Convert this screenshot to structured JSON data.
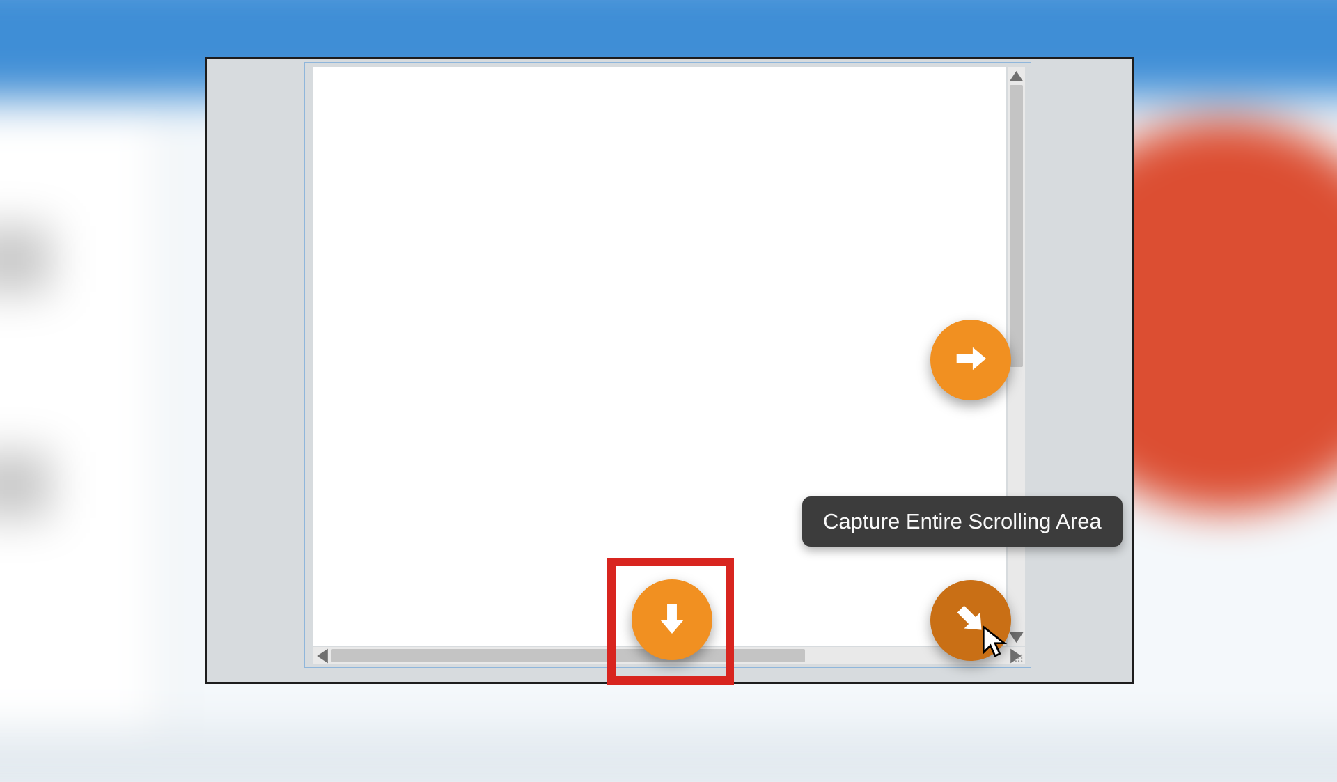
{
  "tooltip": {
    "capture_entire": "Capture Entire Scrolling Area"
  },
  "icons": {
    "scroll_right": "arrow-right-icon",
    "scroll_down": "arrow-down-icon",
    "scroll_diagonal": "arrow-down-right-icon"
  },
  "colors": {
    "button_orange": "#f19021",
    "button_orange_hover": "#c96f15",
    "highlight_red": "#d8251f",
    "tooltip_bg": "#3c3c3c"
  }
}
